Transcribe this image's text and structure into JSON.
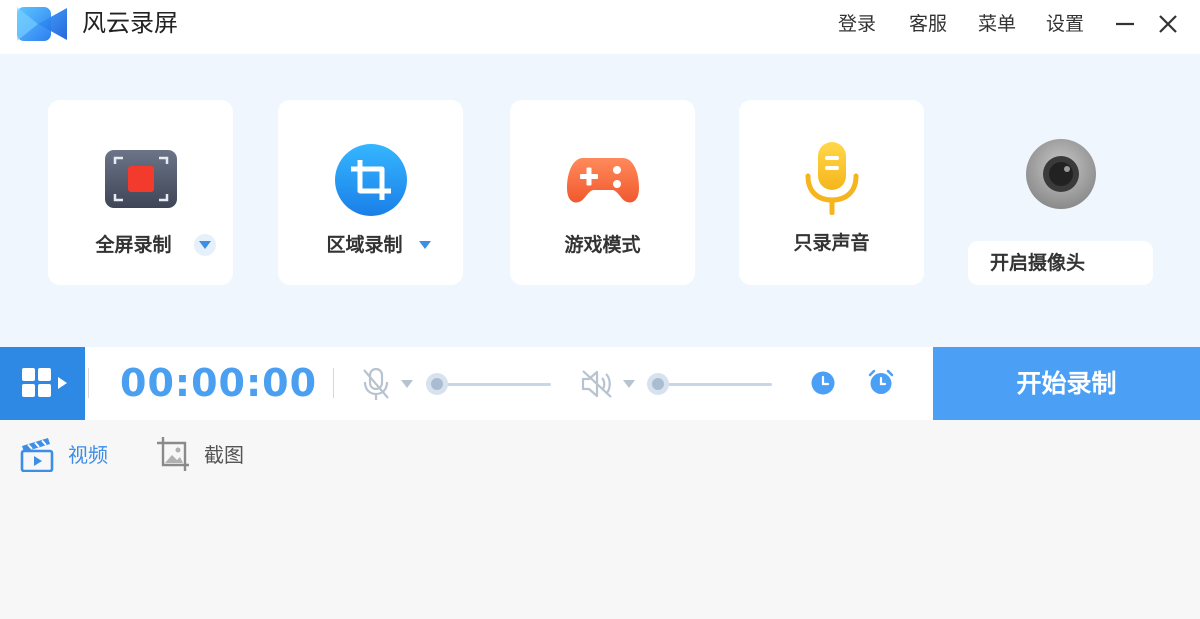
{
  "app": {
    "title": "风云录屏"
  },
  "titlebar": {
    "menu": [
      {
        "id": "login",
        "label": "登录"
      },
      {
        "id": "service",
        "label": "客服"
      },
      {
        "id": "menu",
        "label": "菜单"
      },
      {
        "id": "settings",
        "label": "设置"
      }
    ]
  },
  "modes": [
    {
      "id": "fullscreen",
      "label": "全屏录制",
      "icon": "fullscreen-record-icon",
      "has_dropdown": true
    },
    {
      "id": "region",
      "label": "区域录制",
      "icon": "crop-icon",
      "has_dropdown": true
    },
    {
      "id": "game",
      "label": "游戏模式",
      "icon": "gamepad-icon",
      "has_dropdown": false
    },
    {
      "id": "audio",
      "label": "只录声音",
      "icon": "microphone-icon",
      "has_dropdown": false
    }
  ],
  "camera": {
    "label": "开启摄像头",
    "icon": "camera-icon"
  },
  "controls": {
    "timer": "00:00:00",
    "mic": {
      "icon": "mic-muted-icon",
      "level": 0
    },
    "speaker": {
      "icon": "speaker-muted-icon",
      "level": 0
    },
    "start_label": "开始录制"
  },
  "tabs": [
    {
      "id": "video",
      "label": "视频",
      "active": true,
      "icon": "video-clapper-icon"
    },
    {
      "id": "screenshot",
      "label": "截图",
      "active": false,
      "icon": "image-crop-icon"
    }
  ],
  "colors": {
    "accent": "#2e89e5",
    "start_button": "#4ba0f6",
    "timer": "#4a9ff0",
    "panel_bg": "#f0f6fd",
    "active_tab": "#3d8ee6",
    "inactive_tab": "#666666"
  }
}
